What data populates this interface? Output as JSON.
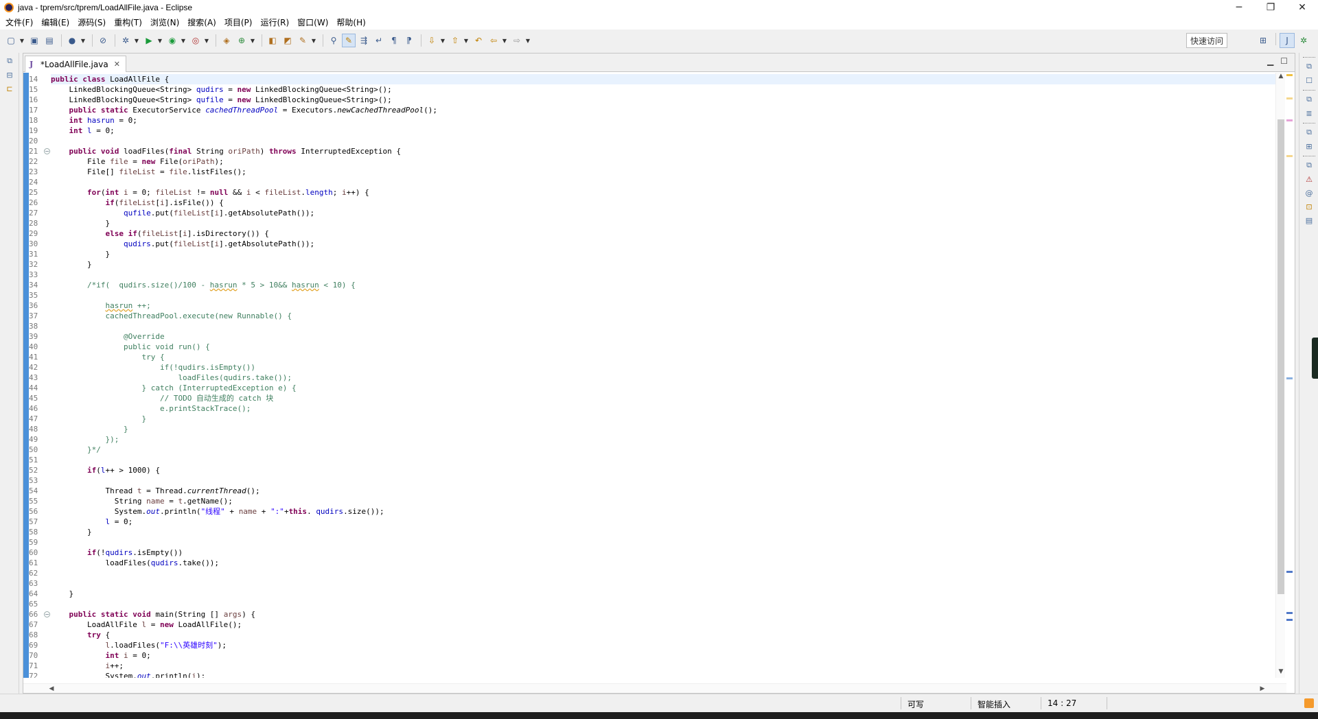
{
  "window": {
    "title": "java - tprem/src/tprem/LoadAllFile.java - Eclipse",
    "buttons": [
      "─",
      "❐",
      "✕"
    ]
  },
  "menu": [
    "文件(F)",
    "编辑(E)",
    "源码(S)",
    "重构(T)",
    "浏览(N)",
    "搜索(A)",
    "项目(P)",
    "运行(R)",
    "窗口(W)",
    "帮助(H)"
  ],
  "toolbar": {
    "quick_access": "快速访问"
  },
  "editor": {
    "tab_label": "*LoadAllFile.java",
    "code": [
      {
        "n": "14",
        "h": "<span class=\"k\">public class</span> LoadAllFile {",
        "hl": true
      },
      {
        "n": "15",
        "h": "    LinkedBlockingQueue&lt;String&gt; <span class=\"f\">qudirs</span> = <span class=\"k\">new</span> LinkedBlockingQueue&lt;String&gt;();"
      },
      {
        "n": "16",
        "h": "    LinkedBlockingQueue&lt;String&gt; <span class=\"f\">qufile</span> = <span class=\"k\">new</span> LinkedBlockingQueue&lt;String&gt;();"
      },
      {
        "n": "17",
        "h": "    <span class=\"k\">public static</span> ExecutorService <span class=\"fs\">cachedThreadPool</span> = Executors.<span class=\"ms\">newCachedThreadPool</span>();"
      },
      {
        "n": "18",
        "h": "    <span class=\"k\">int</span> <span class=\"f\">hasrun</span> = 0;"
      },
      {
        "n": "19",
        "h": "    <span class=\"k\">int</span> <span class=\"f\">l</span> = 0;"
      },
      {
        "n": "20",
        "h": ""
      },
      {
        "n": "21",
        "h": "    <span class=\"k\">public void</span> loadFiles(<span class=\"k\">final</span> String <span class=\"v\">oriPath</span>) <span class=\"k\">throws</span> InterruptedException {",
        "fold": true
      },
      {
        "n": "22",
        "h": "        File <span class=\"v\">file</span> = <span class=\"k\">new</span> File(<span class=\"v\">oriPath</span>);"
      },
      {
        "n": "23",
        "h": "        File[] <span class=\"v\">fileList</span> = <span class=\"v\">file</span>.listFiles();"
      },
      {
        "n": "24",
        "h": ""
      },
      {
        "n": "25",
        "h": "        <span class=\"k\">for</span>(<span class=\"k\">int</span> <span class=\"v\">i</span> = 0; <span class=\"v\">fileList</span> != <span class=\"k\">null</span> &amp;&amp; <span class=\"v\">i</span> &lt; <span class=\"v\">fileList</span>.<span class=\"f\">length</span>; <span class=\"v\">i</span>++) {"
      },
      {
        "n": "26",
        "h": "            <span class=\"k\">if</span>(<span class=\"v\">fileList</span>[<span class=\"v\">i</span>].isFile()) {"
      },
      {
        "n": "27",
        "h": "                <span class=\"f\">qufile</span>.put(<span class=\"v\">fileList</span>[<span class=\"v\">i</span>].getAbsolutePath());"
      },
      {
        "n": "28",
        "h": "            }"
      },
      {
        "n": "29",
        "h": "            <span class=\"k\">else if</span>(<span class=\"v\">fileList</span>[<span class=\"v\">i</span>].isDirectory()) {"
      },
      {
        "n": "30",
        "h": "                <span class=\"f\">qudirs</span>.put(<span class=\"v\">fileList</span>[<span class=\"v\">i</span>].getAbsolutePath());"
      },
      {
        "n": "31",
        "h": "            }"
      },
      {
        "n": "32",
        "h": "        }"
      },
      {
        "n": "33",
        "h": ""
      },
      {
        "n": "34",
        "h": "        <span class=\"c\">/*if(  qudirs.size()/100 - <span class=\"wavy\">hasrun</span> * 5 &gt; 10&amp;&amp; <span class=\"wavy\">hasrun</span> &lt; 10) {</span>"
      },
      {
        "n": "35",
        "h": ""
      },
      {
        "n": "36",
        "h": "            <span class=\"c\"><span class=\"wavy\">hasrun</span> ++;</span>"
      },
      {
        "n": "37",
        "h": "            <span class=\"c\">cachedThreadPool.execute(new Runnable() {</span>"
      },
      {
        "n": "38",
        "h": ""
      },
      {
        "n": "39",
        "h": "                <span class=\"c\">@Override</span>"
      },
      {
        "n": "40",
        "h": "                <span class=\"c\">public void run() {</span>"
      },
      {
        "n": "41",
        "h": "                    <span class=\"c\">try {</span>"
      },
      {
        "n": "42",
        "h": "                        <span class=\"c\">if(!qudirs.isEmpty())</span>"
      },
      {
        "n": "43",
        "h": "                            <span class=\"c\">loadFiles(qudirs.take());</span>"
      },
      {
        "n": "44",
        "h": "                    <span class=\"c\">} catch (InterruptedException e) {</span>"
      },
      {
        "n": "45",
        "h": "                        <span class=\"c\">// TODO 自动生成的 catch 块</span>"
      },
      {
        "n": "46",
        "h": "                        <span class=\"c\">e.printStackTrace();</span>"
      },
      {
        "n": "47",
        "h": "                    <span class=\"c\">}</span>"
      },
      {
        "n": "48",
        "h": "                <span class=\"c\">}</span>"
      },
      {
        "n": "49",
        "h": "            <span class=\"c\">});</span>"
      },
      {
        "n": "50",
        "h": "        <span class=\"c\">}*/</span>"
      },
      {
        "n": "51",
        "h": ""
      },
      {
        "n": "52",
        "h": "        <span class=\"k\">if</span>(<span class=\"f\">l</span>++ &gt; 1000) {"
      },
      {
        "n": "53",
        "h": ""
      },
      {
        "n": "54",
        "h": "            Thread <span class=\"v\">t</span> = Thread.<span class=\"ms\">currentThread</span>();"
      },
      {
        "n": "55",
        "h": "              String <span class=\"v\">name</span> = <span class=\"v\">t</span>.getName();"
      },
      {
        "n": "56",
        "h": "              System.<span class=\"fs\">out</span>.println(<span class=\"s\">\"线程\"</span> + <span class=\"v\">name</span> + <span class=\"s\">\":\"</span>+<span class=\"k\">this</span>. <span class=\"f\">qudirs</span>.size());"
      },
      {
        "n": "57",
        "h": "            <span class=\"f\">l</span> = 0;"
      },
      {
        "n": "58",
        "h": "        }"
      },
      {
        "n": "59",
        "h": ""
      },
      {
        "n": "60",
        "h": "        <span class=\"k\">if</span>(!<span class=\"f\">qudirs</span>.isEmpty())"
      },
      {
        "n": "61",
        "h": "            loadFiles(<span class=\"f\">qudirs</span>.take());"
      },
      {
        "n": "62",
        "h": ""
      },
      {
        "n": "63",
        "h": ""
      },
      {
        "n": "64",
        "h": "    }"
      },
      {
        "n": "65",
        "h": ""
      },
      {
        "n": "66",
        "h": "    <span class=\"k\">public static void</span> main(String [] <span class=\"v\">args</span>) {",
        "fold": true
      },
      {
        "n": "67",
        "h": "        LoadAllFile <span class=\"v\">l</span> = <span class=\"k\">new</span> LoadAllFile();"
      },
      {
        "n": "68",
        "h": "        <span class=\"k\">try</span> {"
      },
      {
        "n": "69",
        "h": "            <span class=\"v\">l</span>.loadFiles(<span class=\"s\">\"F:\\\\英雄时刻\"</span>);"
      },
      {
        "n": "70",
        "h": "            <span class=\"k\">int</span> <span class=\"v\">i</span> = 0;"
      },
      {
        "n": "71",
        "h": "            <span class=\"v\">i</span>++;"
      },
      {
        "n": "72",
        "h": "            System.<span class=\"fs\">out</span>.println(<span class=\"v\">i</span>);"
      }
    ]
  },
  "status": {
    "writable": "可写",
    "insert_mode": "智能插入",
    "position": "14 : 27"
  },
  "colors": {
    "keyword": "#7f0055",
    "field": "#0000c0",
    "comment": "#3f7f5f",
    "string": "#2a00ff",
    "current_line": "#e8f2fe",
    "ruler": "#4a90d9"
  },
  "icons": [
    "new-icon",
    "save-icon",
    "save-all-icon",
    "profile-icon",
    "skip-breakpoints-icon",
    "debug-icon",
    "run-icon",
    "coverage-icon",
    "external-tools-icon",
    "new-java-project-icon",
    "new-package-icon",
    "new-class-icon",
    "open-type-icon",
    "open-task-icon",
    "search-icon",
    "next-annotation-icon",
    "prev-annotation-icon",
    "back-icon",
    "forward-icon",
    "java-perspective-icon",
    "debug-perspective-icon"
  ]
}
